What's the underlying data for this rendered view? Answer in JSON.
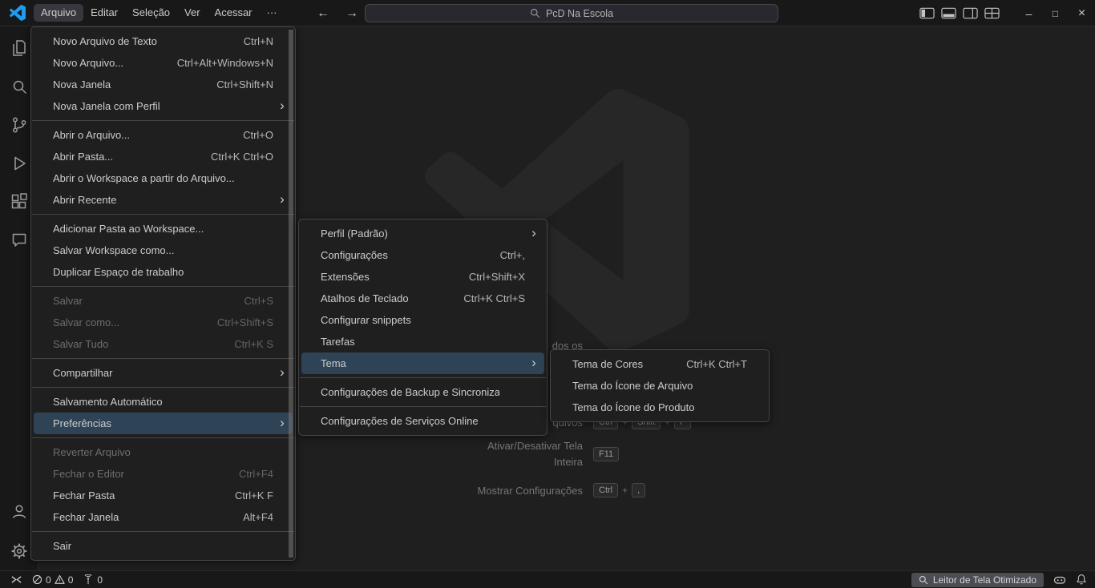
{
  "colors": {
    "brand_blue": "#1f9cf0",
    "menu_selection_background": "#2f4356"
  },
  "icons": {
    "submenu_arrow": "›",
    "back_arrow": "←",
    "forward_arrow": "→",
    "minimize": "–",
    "maximize": "□",
    "close": "×"
  },
  "titlebar": {
    "menu_items": [
      {
        "label": "Arquivo",
        "active": true
      },
      {
        "label": "Editar"
      },
      {
        "label": "Seleção"
      },
      {
        "label": "Ver"
      },
      {
        "label": "Acessar"
      },
      {
        "label": "···"
      }
    ],
    "search_value": "PcD Na Escola"
  },
  "file_menu": {
    "items": [
      {
        "label": "Novo Arquivo de Texto",
        "shortcut": "Ctrl+N"
      },
      {
        "label": "Novo Arquivo...",
        "shortcut": "Ctrl+Alt+Windows+N"
      },
      {
        "label": "Nova Janela",
        "shortcut": "Ctrl+Shift+N"
      },
      {
        "label": "Nova Janela com Perfil",
        "submenu": true
      },
      {
        "separator": true
      },
      {
        "label": "Abrir o Arquivo...",
        "shortcut": "Ctrl+O"
      },
      {
        "label": "Abrir Pasta...",
        "shortcut": "Ctrl+K Ctrl+O"
      },
      {
        "label": "Abrir o Workspace a partir do Arquivo..."
      },
      {
        "label": "Abrir Recente",
        "submenu": true
      },
      {
        "separator": true
      },
      {
        "label": "Adicionar Pasta ao Workspace..."
      },
      {
        "label": "Salvar Workspace como..."
      },
      {
        "label": "Duplicar Espaço de trabalho"
      },
      {
        "separator": true
      },
      {
        "label": "Salvar",
        "shortcut": "Ctrl+S",
        "disabled": true
      },
      {
        "label": "Salvar como...",
        "shortcut": "Ctrl+Shift+S",
        "disabled": true
      },
      {
        "label": "Salvar Tudo",
        "shortcut": "Ctrl+K S",
        "disabled": true
      },
      {
        "separator": true
      },
      {
        "label": "Compartilhar",
        "submenu": true
      },
      {
        "separator": true
      },
      {
        "label": "Salvamento Automático"
      },
      {
        "label": "Preferências",
        "submenu": true,
        "selected": true
      },
      {
        "separator": true
      },
      {
        "label": "Reverter Arquivo",
        "disabled": true
      },
      {
        "label": "Fechar o Editor",
        "shortcut": "Ctrl+F4",
        "disabled": true
      },
      {
        "label": "Fechar Pasta",
        "shortcut": "Ctrl+K F"
      },
      {
        "label": "Fechar Janela",
        "shortcut": "Alt+F4"
      },
      {
        "separator": true
      },
      {
        "label": "Sair"
      }
    ]
  },
  "preferences_menu": {
    "items": [
      {
        "label": "Perfil (Padrão)",
        "submenu": true
      },
      {
        "label": "Configurações",
        "shortcut": "Ctrl+,"
      },
      {
        "label": "Extensões",
        "shortcut": "Ctrl+Shift+X"
      },
      {
        "label": "Atalhos de Teclado",
        "shortcut": "Ctrl+K Ctrl+S"
      },
      {
        "label": "Configurar snippets"
      },
      {
        "label": "Tarefas"
      },
      {
        "label": "Tema",
        "submenu": true,
        "selected": true
      },
      {
        "separator": true
      },
      {
        "label": "Configurações de Backup e Sincronização..."
      },
      {
        "separator": true
      },
      {
        "label": "Configurações de Serviços Online"
      }
    ]
  },
  "theme_menu": {
    "items": [
      {
        "label": "Tema de Cores",
        "shortcut": "Ctrl+K Ctrl+T"
      },
      {
        "label": "Tema do Ícone de Arquivo"
      },
      {
        "label": "Tema do Ícone do Produto"
      }
    ]
  },
  "watermark": {
    "row1": {
      "label": "dos os"
    },
    "row2": {
      "label": "quivos",
      "k1": "Ctrl",
      "k2": "Shift",
      "k3": "F",
      "sep": "+"
    },
    "row3": {
      "label_line1": "Ativar/Desativar Tela",
      "label_line2": "Inteira",
      "k1": "F11"
    },
    "row4": {
      "label": "Mostrar Configurações",
      "k1": "Ctrl",
      "k2": ",",
      "sep": "+"
    }
  },
  "statusbar": {
    "errors": "0",
    "warnings": "0",
    "ports": "0",
    "screen_reader_label": "Leitor de Tela Otimizado"
  }
}
